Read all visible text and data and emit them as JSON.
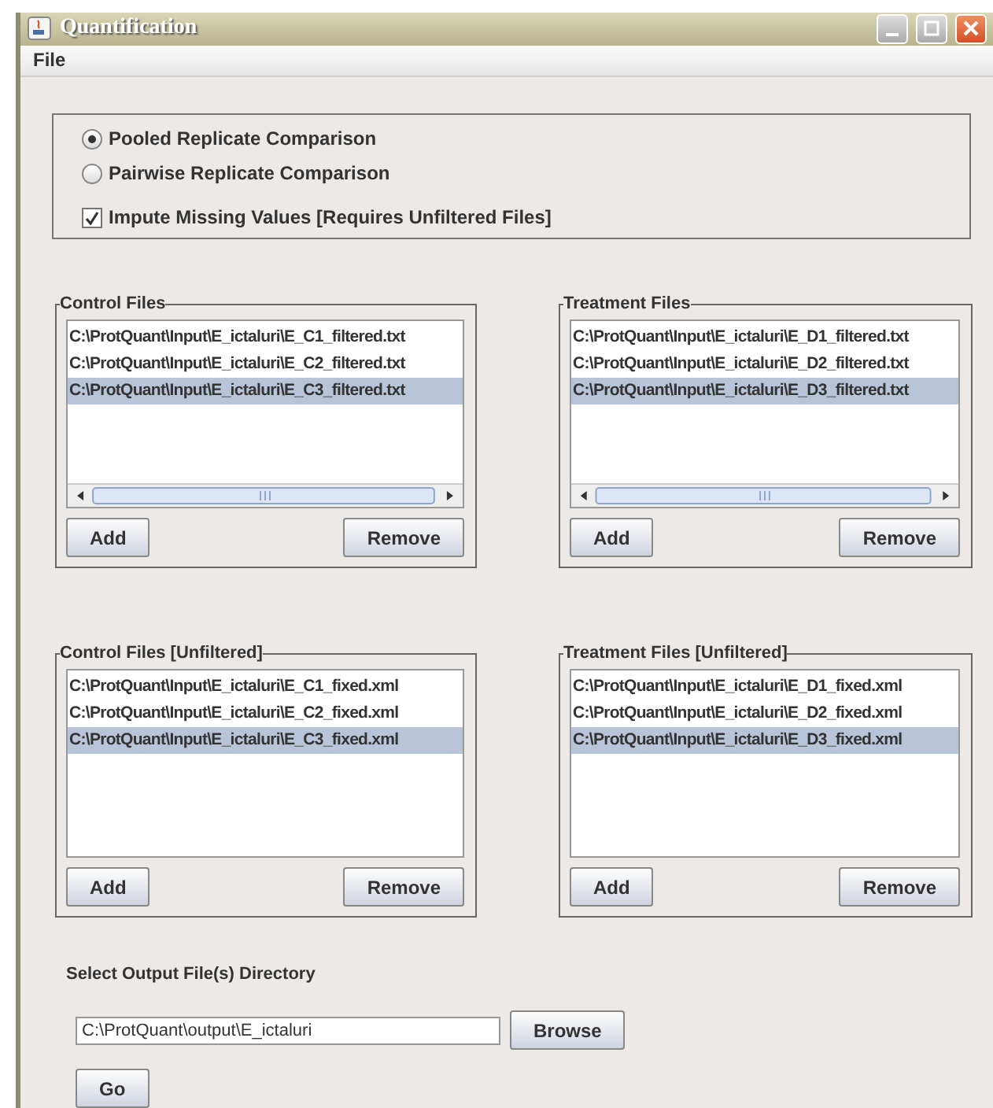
{
  "window": {
    "title": "Quantification"
  },
  "menu": [
    "File"
  ],
  "modes": [
    {
      "label": "Pooled Replicate Comparison",
      "selected": true
    },
    {
      "label": "Pairwise Replicate Comparison",
      "selected": false
    }
  ],
  "impute": {
    "label": "Impute Missing Values [Requires Unfiltered Files]",
    "checked": true
  },
  "panels": [
    {
      "title": "Control Files",
      "scrollbar": true,
      "items": [
        {
          "text": "C:\\ProtQuant\\Input\\E_ictaluri\\E_C1_filtered.txt",
          "selected": false
        },
        {
          "text": "C:\\ProtQuant\\Input\\E_ictaluri\\E_C2_filtered.txt",
          "selected": false
        },
        {
          "text": "C:\\ProtQuant\\Input\\E_ictaluri\\E_C3_filtered.txt",
          "selected": true
        }
      ],
      "buttons": [
        "Add",
        "Remove"
      ]
    },
    {
      "title": "Treatment Files",
      "scrollbar": true,
      "items": [
        {
          "text": "C:\\ProtQuant\\Input\\E_ictaluri\\E_D1_filtered.txt",
          "selected": false
        },
        {
          "text": "C:\\ProtQuant\\Input\\E_ictaluri\\E_D2_filtered.txt",
          "selected": false
        },
        {
          "text": "C:\\ProtQuant\\Input\\E_ictaluri\\E_D3_filtered.txt",
          "selected": true
        }
      ],
      "buttons": [
        "Add",
        "Remove"
      ]
    },
    {
      "title": "Control Files [Unfiltered]",
      "scrollbar": false,
      "items": [
        {
          "text": "C:\\ProtQuant\\Input\\E_ictaluri\\E_C1_fixed.xml",
          "selected": false
        },
        {
          "text": "C:\\ProtQuant\\Input\\E_ictaluri\\E_C2_fixed.xml",
          "selected": false
        },
        {
          "text": "C:\\ProtQuant\\Input\\E_ictaluri\\E_C3_fixed.xml",
          "selected": true
        }
      ],
      "buttons": [
        "Add",
        "Remove"
      ]
    },
    {
      "title": "Treatment Files [Unfiltered]",
      "scrollbar": false,
      "items": [
        {
          "text": "C:\\ProtQuant\\Input\\E_ictaluri\\E_D1_fixed.xml",
          "selected": false
        },
        {
          "text": "C:\\ProtQuant\\Input\\E_ictaluri\\E_D2_fixed.xml",
          "selected": false
        },
        {
          "text": "C:\\ProtQuant\\Input\\E_ictaluri\\E_D3_fixed.xml",
          "selected": true
        }
      ],
      "buttons": [
        "Add",
        "Remove"
      ]
    }
  ],
  "output": {
    "label": "Select Output File(s) Directory",
    "value": "C:\\ProtQuant\\output\\E_ictaluri",
    "browse": "Browse",
    "go": "Go"
  }
}
